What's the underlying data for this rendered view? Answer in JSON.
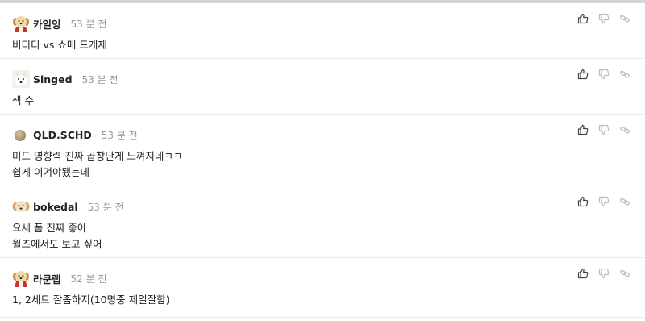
{
  "comments": [
    {
      "avatar": "puppy-santa-icon",
      "nickname": "카일잉",
      "time": "53 분 전",
      "lines": [
        "비디디 vs 쇼메 드개재"
      ]
    },
    {
      "avatar": "white-dog-icon",
      "nickname": "Singed",
      "time": "53 분 전",
      "lines": [
        "섹 수"
      ]
    },
    {
      "avatar": "brown-dot-icon",
      "nickname": "QLD.SCHD",
      "time": "53 분 전",
      "lines": [
        "미드 영향력 진짜 곱창난게 느껴지네ㅋㅋ",
        "쉽게 이겨야됐는데"
      ]
    },
    {
      "avatar": "puppy-icon",
      "nickname": "bokedal",
      "time": "53 분 전",
      "lines": [
        "요새 폼 진짜 좋아",
        "월즈에서도 보고 싶어"
      ]
    },
    {
      "avatar": "puppy-santa-icon",
      "nickname": "라쿤랩",
      "time": "52 분 전",
      "lines": [
        "1, 2세트 잘좀하지(10명중 제일잘함)"
      ]
    }
  ],
  "actions": {
    "like_icon": "thumbs-up-icon",
    "dislike_icon": "thumbs-down-icon",
    "link_icon": "link-icon"
  },
  "colors": {
    "nickname": "#222222",
    "time": "#999999",
    "body_text": "#1a1a1a",
    "divider": "#ececec",
    "icon_dark": "#444444",
    "icon_light": "#bbbbbb"
  }
}
